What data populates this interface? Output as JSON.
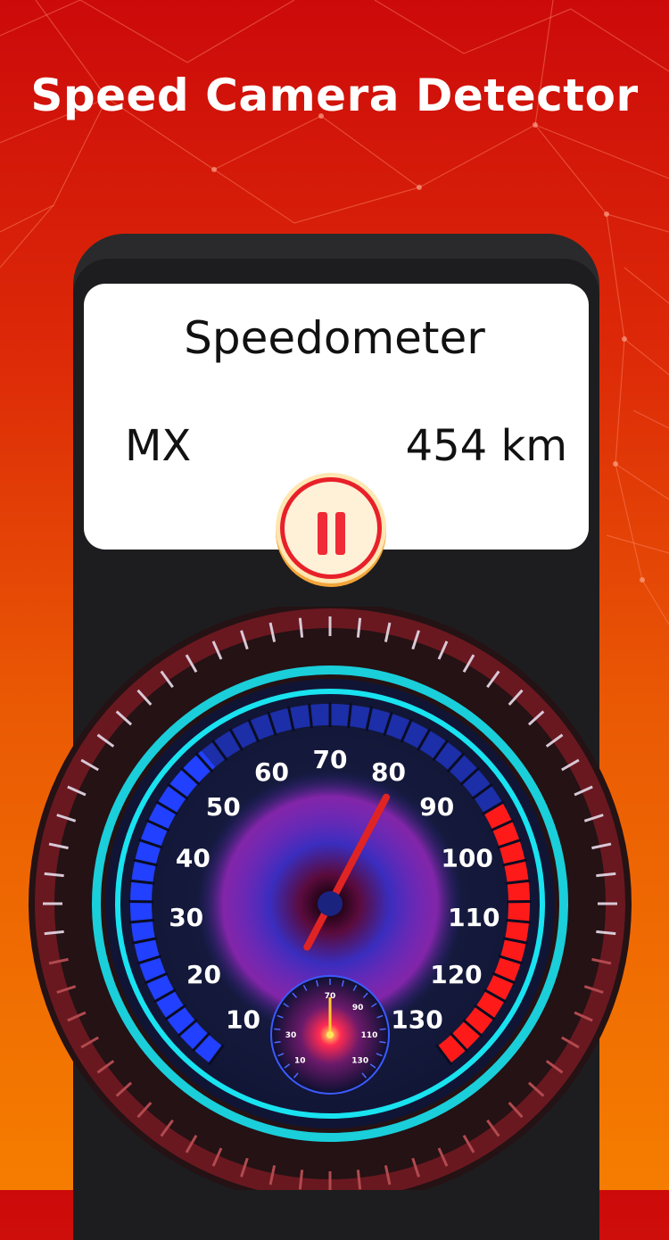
{
  "headline": "Speed Camera Detector",
  "card": {
    "title": "Speedometer",
    "max_label": "MX",
    "distance": "454 km"
  },
  "pause_icon": "pause-icon",
  "gauge": {
    "main_ticks": [
      "10",
      "20",
      "30",
      "40",
      "50",
      "60",
      "70",
      "80",
      "90",
      "100",
      "110",
      "120",
      "130"
    ],
    "mini_ticks": [
      "10",
      "30",
      "70",
      "90",
      "110",
      "130"
    ],
    "needle_value": 80,
    "colors": {
      "ring": "#19e3f0",
      "blue_zone": "#2140ff",
      "red_zone": "#ff1a1a",
      "needle": "#e02424",
      "hub": "#1a237e"
    }
  }
}
